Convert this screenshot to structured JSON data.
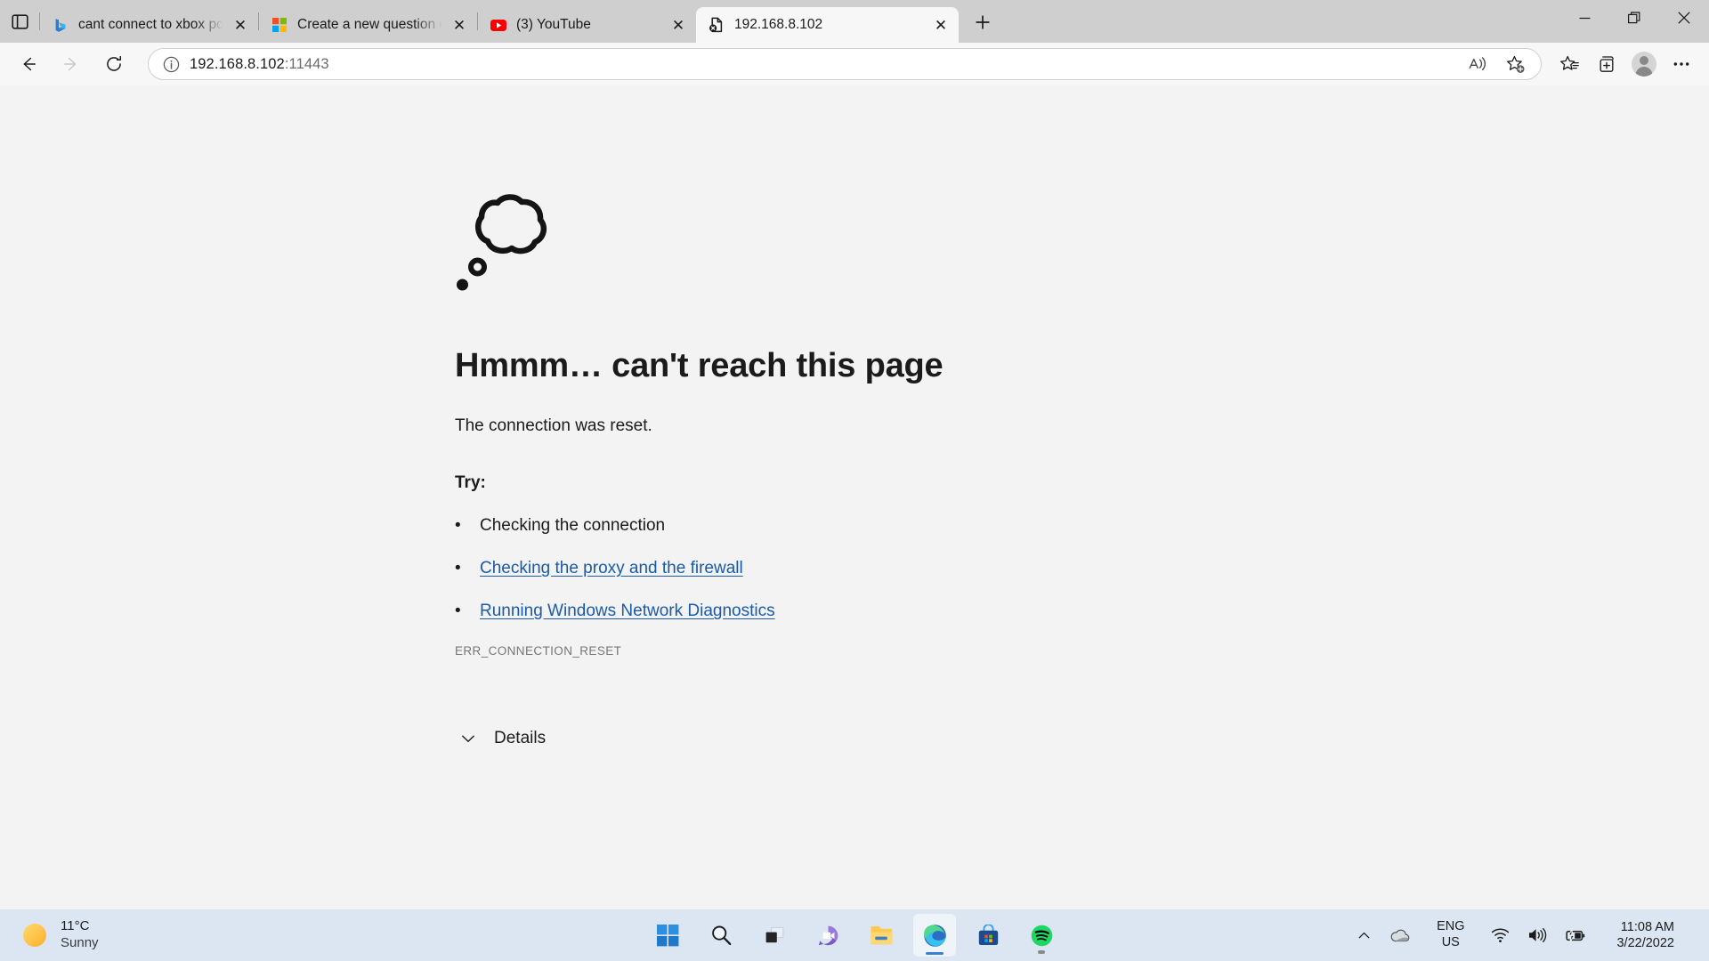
{
  "window": {
    "controls": {
      "minimize": "−",
      "restore": "restore-icon",
      "close": "✕"
    }
  },
  "tabstrip": {
    "tab_search_label": "tab-search",
    "new_tab_label": "+",
    "close_label": "✕",
    "tabs": [
      {
        "title": "cant connect to xbox portal conn",
        "favicon": "bing-icon",
        "active": false
      },
      {
        "title": "Create a new question or start a",
        "favicon": "microsoft-icon",
        "active": false
      },
      {
        "title": "(3) YouTube",
        "favicon": "youtube-icon",
        "active": false
      },
      {
        "title": "192.168.8.102",
        "favicon": "page-error-icon",
        "active": true
      }
    ]
  },
  "toolbar": {
    "back_label": "Back",
    "forward_label": "Forward",
    "refresh_label": "Refresh",
    "site_info_label": "View site information",
    "url_host": "192.168.8.102",
    "url_port": ":11443",
    "read_aloud_label": "Read aloud",
    "add_favorite_label": "Add this page to favorites",
    "favorites_label": "Favorites",
    "collections_label": "Collections",
    "profile_label": "Profile",
    "settings_label": "Settings and more"
  },
  "error_page": {
    "icon": "thought-bubble-icon",
    "heading": "Hmmm… can't reach this page",
    "subtext": "The connection was reset.",
    "try_label": "Try:",
    "bullet": "•",
    "suggestions": [
      {
        "text": "Checking the connection",
        "link": false
      },
      {
        "text": "Checking the proxy and the firewall",
        "link": true
      },
      {
        "text": "Running Windows Network Diagnostics",
        "link": true
      }
    ],
    "error_code": "ERR_CONNECTION_RESET",
    "details_label": "Details"
  },
  "taskbar": {
    "weather": {
      "temperature": "11°C",
      "condition": "Sunny",
      "icon": "sun-icon"
    },
    "items": [
      {
        "name": "start",
        "icon": "windows-icon",
        "state": ""
      },
      {
        "name": "search",
        "icon": "search-icon",
        "state": ""
      },
      {
        "name": "task-view",
        "icon": "task-view-icon",
        "state": ""
      },
      {
        "name": "chat",
        "icon": "chat-icon",
        "state": ""
      },
      {
        "name": "file-explorer",
        "icon": "folder-icon",
        "state": ""
      },
      {
        "name": "edge",
        "icon": "edge-icon",
        "state": "active"
      },
      {
        "name": "microsoft-store",
        "icon": "store-icon",
        "state": ""
      },
      {
        "name": "spotify",
        "icon": "spotify-icon",
        "state": "running"
      }
    ],
    "tray": {
      "show_hidden_label": "Show hidden icons",
      "onedrive_label": "OneDrive",
      "language_line1": "ENG",
      "language_line2": "US",
      "network_label": "Network",
      "volume_label": "Volume",
      "battery_label": "Battery charging",
      "time": "11:08 AM",
      "date": "3/22/2022"
    }
  },
  "colors": {
    "accent": "#3a7fd5",
    "link": "#1a5aa8",
    "tabstrip_bg": "#cfcfcf",
    "taskbar_bg": "#dce6f2",
    "page_bg": "#f3f3f3"
  }
}
